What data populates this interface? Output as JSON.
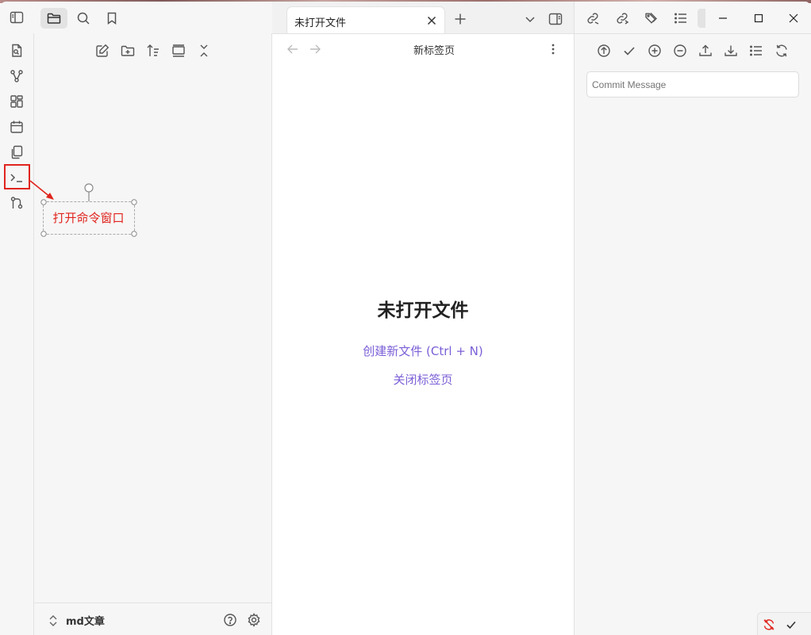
{
  "tab": {
    "title": "未打开文件"
  },
  "view_header": {
    "title": "新标签页"
  },
  "empty_state": {
    "title": "未打开文件",
    "create_link": "创建新文件 (Ctrl + N)",
    "close_link": "关闭标签页"
  },
  "git_panel": {
    "commit_placeholder": "Commit Message"
  },
  "vault": {
    "name": "md文章"
  },
  "annotation": {
    "label": "打开命令窗口"
  },
  "colors": {
    "accent": "#7b5fd6",
    "annotation_red": "#e0241e"
  },
  "icons": {
    "ribbon": [
      "quick-switcher-icon",
      "graph-view-icon",
      "canvas-icon",
      "daily-note-icon",
      "templates-icon",
      "command-palette-icon",
      "git-icon"
    ],
    "explorer_toolbar": [
      "new-note-icon",
      "new-folder-icon",
      "sort-icon",
      "auto-reveal-icon",
      "collapse-all-icon"
    ],
    "git_toolbar": [
      "push-icon",
      "commit-icon",
      "stage-all-icon",
      "unstage-all-icon",
      "upload-icon",
      "pull-icon",
      "list-icon",
      "refresh-icon"
    ]
  }
}
